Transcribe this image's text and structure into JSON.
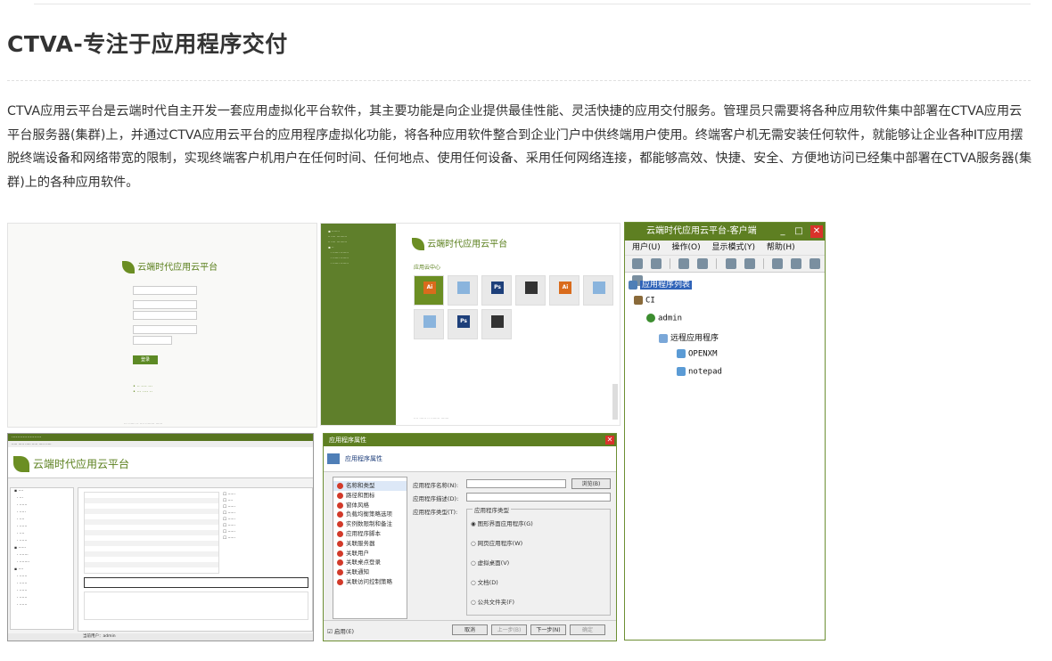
{
  "page": {
    "title": "CTVA-专注于应用程序交付",
    "description": "CTVA应用云平台是云端时代自主开发一套应用虚拟化平台软件，其主要功能是向企业提供最佳性能、灵活快捷的应用交付服务。管理员只需要将各种应用软件集中部署在CTVA应用云平台服务器(集群)上，并通过CTVA应用云平台的应用程序虚拟化功能，将各种应用软件整合到企业门户中供终端用户使用。终端客户机无需安装任何软件，就能够让企业各种IT应用摆脱终端设备和网络带宽的限制，实现终端客户机用户在任何时间、任何地点、使用任何设备、采用任何网络连接，都能够高效、快捷、安全、方便地访问已经集中部署在CTVA服务器(集群)上的各种应用软件。"
  },
  "login_shot": {
    "brand": "云端时代应用云平台",
    "login_button": "登录"
  },
  "appcenter_shot": {
    "brand": "云端时代应用云平台",
    "section": "应用云中心",
    "tiles": [
      {
        "icon": "Ai",
        "color": "#d96b1c",
        "active": true
      },
      {
        "icon": "",
        "color": "#8ab4dd",
        "active": false
      },
      {
        "icon": "Ps",
        "color": "#1d3f7a",
        "active": false
      },
      {
        "icon": "",
        "color": "#333333",
        "active": false
      },
      {
        "icon": "Ai",
        "color": "#d96b1c",
        "active": false
      },
      {
        "icon": "",
        "color": "#8ab4dd",
        "active": false
      },
      {
        "icon": "",
        "color": "#8ab4dd",
        "active": false
      },
      {
        "icon": "Ps",
        "color": "#1d3f7a",
        "active": false
      },
      {
        "icon": "",
        "color": "#333333",
        "active": false
      }
    ]
  },
  "client_shot": {
    "title": "云端时代应用云平台-客户端",
    "menu": [
      "用户(U)",
      "操作(O)",
      "显示模式(Y)",
      "帮助(H)"
    ],
    "tree": {
      "root": "应用程序列表",
      "server": "CI",
      "user": "admin",
      "folder": "远程应用程序",
      "apps": [
        "OPENXM",
        "notepad"
      ]
    }
  },
  "admin_shot": {
    "banner": "云端时代应用云平台",
    "status_user": "当前用户：admin"
  },
  "dialog_shot": {
    "title": "应用程序属性",
    "header": "应用程序属性",
    "nav": [
      "名称和类型",
      "路径和图标",
      "窗体风格",
      "负载均衡策略选项",
      "实例数限制和备注",
      "应用程序脚本",
      "关联服务器",
      "关联用户",
      "关联桌点登录",
      "关联通知",
      "关联访问控制策略"
    ],
    "fields": {
      "name_label": "应用程序名称(N):",
      "desc_label": "应用程序描述(D):",
      "type_label": "应用程序类型(T):",
      "browse_button": "浏览(B)",
      "group_title": "应用程序类型",
      "types": [
        "图形界面应用程序(G)",
        "网页应用程序(W)",
        "虚拟桌面(V)",
        "文档(D)",
        "公共文件夹(F)"
      ]
    },
    "buttons": {
      "cancel": "取消",
      "prev": "上一步(B)",
      "next": "下一步(N)",
      "ok": "确定"
    },
    "enable_label": "启用(E)"
  }
}
